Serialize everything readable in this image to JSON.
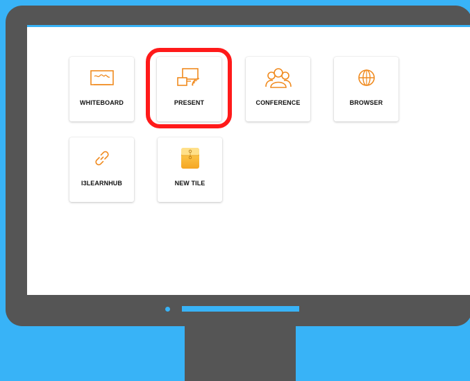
{
  "colors": {
    "background": "#38b3f7",
    "monitor": "#555555",
    "screen": "#ffffff",
    "accent_orange": "#f08a1e",
    "highlight": "#ff1a1a"
  },
  "tiles": [
    {
      "label": "WHITEBOARD",
      "icon": "whiteboard-icon"
    },
    {
      "label": "PRESENT",
      "icon": "screen-cast-icon",
      "highlighted": true
    },
    {
      "label": "CONFERENCE",
      "icon": "people-group-icon"
    },
    {
      "label": "BROWSER",
      "icon": "globe-icon"
    },
    {
      "label": "I3LEARNHUB",
      "icon": "link-icon"
    },
    {
      "label": "NEW TILE",
      "icon": "folder-envelope-icon"
    }
  ]
}
